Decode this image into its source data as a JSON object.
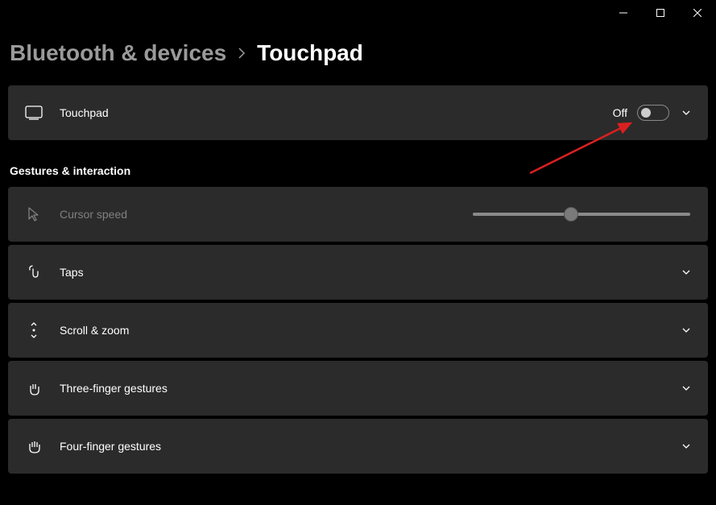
{
  "breadcrumb": {
    "parent": "Bluetooth & devices",
    "current": "Touchpad"
  },
  "touchpad": {
    "label": "Touchpad",
    "toggle_state_label": "Off",
    "toggle_on": false
  },
  "gestures": {
    "header": "Gestures & interaction",
    "cursor_speed": {
      "label": "Cursor speed",
      "slider_value": 0.45
    },
    "taps": {
      "label": "Taps"
    },
    "scroll_zoom": {
      "label": "Scroll & zoom"
    },
    "three_finger": {
      "label": "Three-finger gestures"
    },
    "four_finger": {
      "label": "Four-finger gestures"
    }
  }
}
